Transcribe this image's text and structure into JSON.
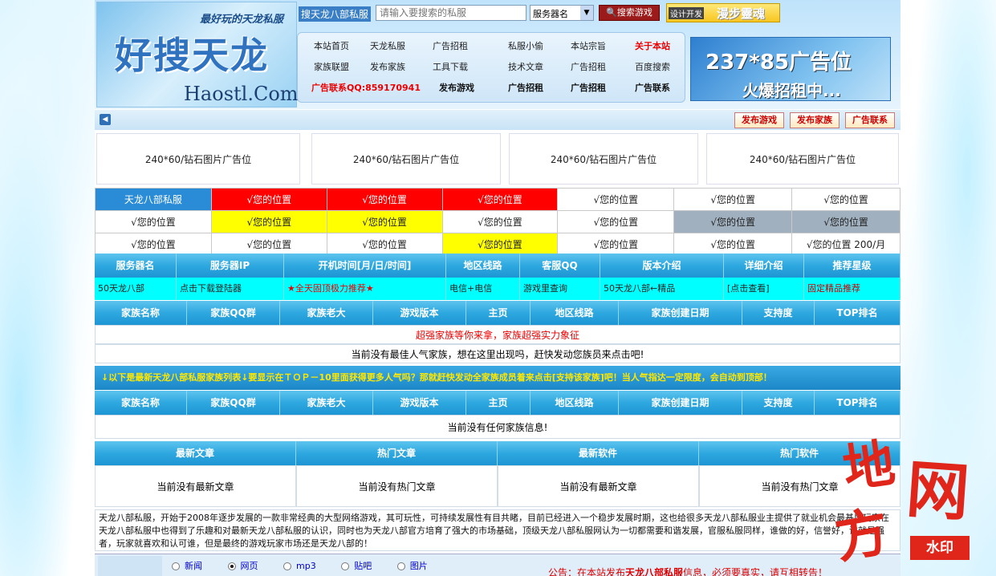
{
  "header": {
    "slogan": "最好玩的天龙私服",
    "logo_text": "好搜天龙",
    "domain": "Haostl.Com",
    "search_label": "搜天龙八部私服",
    "search_placeholder": "请输入要搜索的私服",
    "select_value": "服务器名",
    "search_button": "搜索游戏",
    "ad_small_1": "设计开发",
    "ad_small_2": "漫步靈魂",
    "banner_line1": "237*85广告位",
    "banner_line2": "火爆招租中..."
  },
  "nav": [
    [
      "本站首页",
      "天龙私服",
      "广告招租",
      "私服小偷",
      "本站宗旨",
      "关于本站"
    ],
    [
      "家族联盟",
      "发布家族",
      "工具下载",
      "技术文章",
      "广告招租",
      "百度搜索"
    ],
    [
      "广告联系QQ:859170941",
      "发布游戏",
      "广告招租",
      "广告招租",
      "广告联系"
    ]
  ],
  "toolbar": {
    "buttons": [
      "发布游戏",
      "发布家族",
      "广告联系"
    ]
  },
  "ads": [
    "240*60/钻石图片广告位",
    "240*60/钻石图片广告位",
    "240*60/钻石图片广告位",
    "240*60/钻石图片广告位"
  ],
  "grid": {
    "first_cell": "天龙八部私服",
    "cell_text": "√您的位置",
    "last_cell": "√您的位置 200/月"
  },
  "servers": {
    "headers": [
      "服务器名",
      "服务器IP",
      "开机时间[月/日/时间]",
      "地区线路",
      "客服QQ",
      "版本介绍",
      "详细介绍",
      "推荐星级"
    ],
    "row": [
      "50天龙八部",
      "点击下载登陆器",
      "★全天固顶极力推荐★",
      "电信+电信",
      "游戏里查询",
      "50天龙八部←精品",
      "[点击查看]",
      "固定精品推荐"
    ]
  },
  "family": {
    "headers": [
      "家族名称",
      "家族QQ群",
      "家族老大",
      "游戏版本",
      "主页",
      "地区线路",
      "家族创建日期",
      "支持度",
      "TOP排名"
    ],
    "banner": "超强家族等你来拿，家族超强实力象征",
    "empty": "当前没有最佳人气家族，想在这里出现吗，赶快发动您族员来点击吧!"
  },
  "marquee": "↓以下是最新天龙八部私服家族列表↓要显示在ＴＯＰ－10里面获得更多人气吗？那就赶快发动全家族成员着来点击[支持该家族]吧！当人气指达一定限度，会自动到顶部！",
  "family2": {
    "headers": [
      "家族名称",
      "家族QQ群",
      "家族老大",
      "游戏版本",
      "主页",
      "地区线路",
      "家族创建日期",
      "支持度",
      "TOP排名"
    ],
    "empty": "当前没有任何家族信息!"
  },
  "articles": {
    "headers": [
      "最新文章",
      "热门文章",
      "最新软件",
      "热门软件"
    ],
    "values": [
      "当前没有最新文章",
      "当前没有热门文章",
      "当前没有最新文章",
      "当前没有热门文章"
    ]
  },
  "intro": "天龙八部私服，开始于2008年逐步发展的一款非常经典的大型网络游戏，其可玩性，可持续发展性有目共睹，目前已经进入一个稳步发展时期，这也给很多天龙八部私服业主提供了就业机会最基层玩家在天龙八部私服中也得到了乐趣和对最新天龙八部私服的认识，同时也为天龙八部官方培育了强大的市场基础，顶级天龙八部私服网认为一切都需要和谐发展，官服私服同样，谁做的好，信誉好，谁就是强者，玩家就喜欢和认可谁，但是最终的游戏玩家市场还是天龙八部的！",
  "bottom": {
    "radios": [
      "新闻",
      "网页",
      "mp3",
      "贴吧",
      "图片"
    ],
    "notice_pre": "公告：在本站发布",
    "notice_bold": "天龙八部私服",
    "notice_post": "信息，必须要真实，请互相转告！"
  },
  "watermark": {
    "c1": "地",
    "c2": "网",
    "c3": "方",
    "stamp": "水印"
  }
}
